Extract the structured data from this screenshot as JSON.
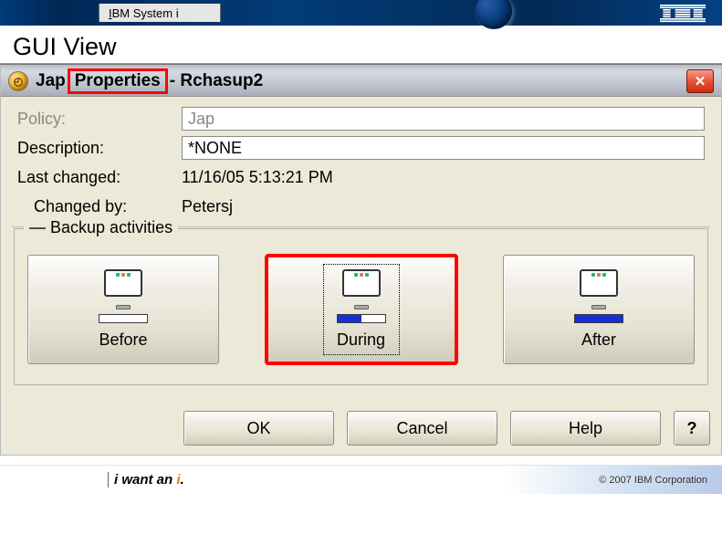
{
  "header": {
    "product": "IBM System i",
    "first_underlined_char": "I",
    "rest": "BM System i"
  },
  "page_title": "GUI View",
  "dialog": {
    "title_seg1": "Jap",
    "title_highlight": "Properties",
    "title_seg3": "Rchasup2",
    "close_symbol": "✕",
    "fields": {
      "policy_label": "Policy:",
      "policy_value": "Jap",
      "description_label": "Description:",
      "description_value": "*NONE",
      "last_changed_label": "Last changed:",
      "last_changed_value": "11/16/05 5:13:21 PM",
      "changed_by_label": "Changed by:",
      "changed_by_value": "Petersj"
    },
    "group_legend": "Backup activities",
    "activities": {
      "before": "Before",
      "during": "During",
      "after": "After"
    },
    "buttons": {
      "ok": "OK",
      "cancel": "Cancel",
      "help": "Help",
      "what": "?"
    }
  },
  "footer": {
    "tagline_pre": "i want an ",
    "tagline_i": "i",
    "tagline_post": ".",
    "copyright": "© 2007 IBM Corporation"
  }
}
